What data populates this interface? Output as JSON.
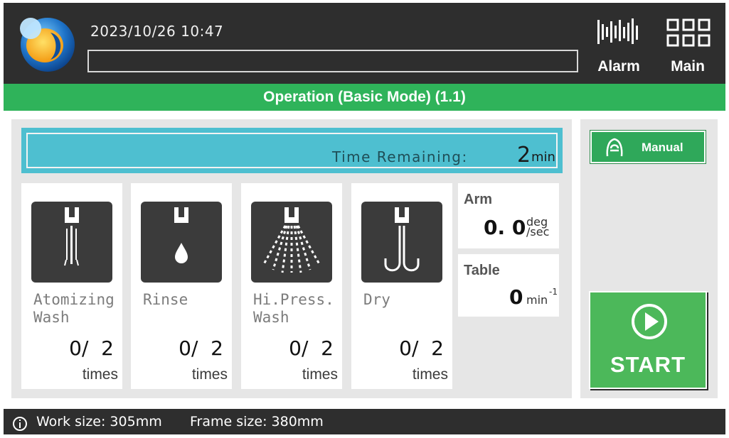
{
  "header": {
    "datetime": "2023/10/26  10:47",
    "message": "",
    "alarm_label": "Alarm",
    "main_label": "Main"
  },
  "title": "Operation (Basic Mode) (1.1)",
  "time_remaining": {
    "label": "Time Remaining:",
    "value": "2",
    "unit": "min"
  },
  "steps": [
    {
      "icon": "atomizing-wash-nozzle-icon",
      "name": "Atomizing\nWash",
      "count": "0/  2",
      "unit": "times"
    },
    {
      "icon": "rinse-drop-icon",
      "name": "Rinse",
      "count": "0/  2",
      "unit": "times"
    },
    {
      "icon": "high-pressure-spray-icon",
      "name": "Hi.Press.\nWash",
      "count": "0/  2",
      "unit": "times"
    },
    {
      "icon": "dry-air-icon",
      "name": "Dry",
      "count": "0/  2",
      "unit": "times"
    }
  ],
  "arm": {
    "label": "Arm",
    "value": "0. 0",
    "unit_top": "deg",
    "unit_bottom": "/sec"
  },
  "table": {
    "label": "Table",
    "value": "0",
    "unit": "min",
    "unit_sup": "-1"
  },
  "side": {
    "manual_label": "Manual",
    "start_label": "START"
  },
  "footer": {
    "work_size": "Work size: 305mm",
    "frame_size": "Frame size: 380mm"
  },
  "colors": {
    "header_bg": "#2e2e2e",
    "title_green": "#2fb35a",
    "time_cyan": "#4ebfd0",
    "start_green": "#4cb85a",
    "panel_gray": "#e6e6e6"
  }
}
